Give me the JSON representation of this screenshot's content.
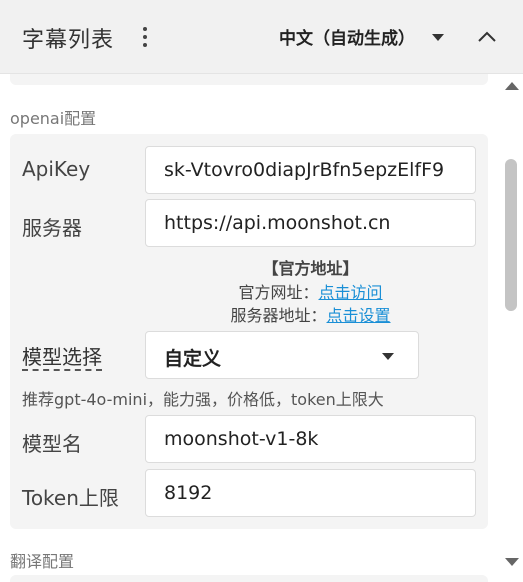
{
  "header": {
    "title": "字幕列表",
    "menu_icon": "more-vertical-icon",
    "language": "中文（自动生成）",
    "collapse_icon": "chevron-up-icon"
  },
  "sections": {
    "openai_label": "openai配置",
    "translate_label": "翻译配置"
  },
  "fields": {
    "apikey_label": "ApiKey",
    "apikey_value": "sk-Vtovro0diapJrBfn5epzElfF9",
    "server_label": "服务器",
    "server_value": "https://api.moonshot.cn",
    "model_label": "模型选择",
    "model_value": "自定义",
    "model_name_label": "模型名",
    "model_name_value": "moonshot-v1-8k",
    "token_label": "Token上限",
    "token_value": "8192"
  },
  "official": {
    "title": "【官方地址】",
    "site_label": "官方网址：",
    "site_link": "点击访问",
    "server_label": "服务器地址：",
    "server_link": "点击设置"
  },
  "hint": "推荐gpt-4o-mini，能力强，价格低，token上限大",
  "colors": {
    "accent": "#1ea3e0",
    "link": "#1a8fd6",
    "card_bg": "#f4f4f4",
    "header_bg": "#f1f1f1"
  }
}
